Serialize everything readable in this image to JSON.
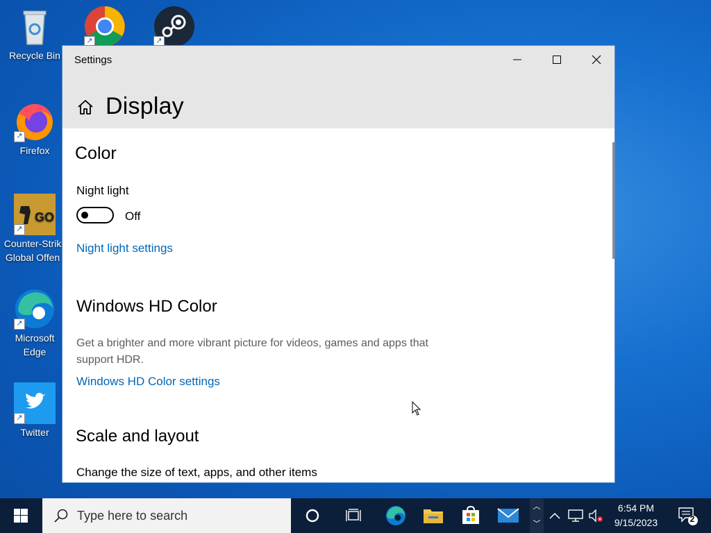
{
  "desktop": {
    "icons": [
      {
        "label": "Recycle Bin"
      },
      {
        "label": "Firefox"
      },
      {
        "label": "Counter-Strike: Global Offensive",
        "line1": "Counter-Strik",
        "line2": "Global Offen"
      },
      {
        "label": "Microsoft Edge",
        "line1": "Microsoft",
        "line2": "Edge"
      },
      {
        "label": "Twitter"
      }
    ],
    "top_icons": [
      "chrome-icon",
      "steam-icon"
    ]
  },
  "window": {
    "title": "Settings",
    "page_title": "Display",
    "controls": {
      "minimize": "minimize",
      "maximize": "maximize",
      "close": "close"
    }
  },
  "color_section": {
    "heading": "Color",
    "night_light_label": "Night light",
    "night_light_state": "Off",
    "night_light_on": false,
    "night_light_link": "Night light settings"
  },
  "hd_section": {
    "heading": "Windows HD Color",
    "description_line1": "Get a brighter and more vibrant picture for videos, games and apps that",
    "description_line2": "support HDR.",
    "link": "Windows HD Color settings"
  },
  "scale_section": {
    "heading": "Scale and layout",
    "description": "Change the size of text, apps, and other items"
  },
  "taskbar": {
    "search_placeholder": "Type here to search",
    "pinned": [
      "cortana-icon",
      "task-view-icon",
      "edge-icon",
      "file-explorer-icon",
      "store-icon",
      "mail-icon"
    ],
    "time": "6:54 PM",
    "date": "9/15/2023",
    "notification_count": "2"
  },
  "colors": {
    "link": "#0067b8",
    "titlebar": "#e6e6e6",
    "taskbar": "#0b1f3a",
    "desktop": "#1670cf"
  }
}
